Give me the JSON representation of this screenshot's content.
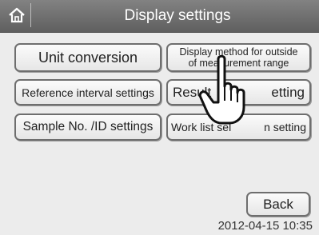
{
  "header": {
    "title": "Display settings",
    "home_icon": "home-icon"
  },
  "buttons": {
    "unit_conversion": "Unit conversion",
    "display_method_line1": "Display method for outside",
    "display_method_line2": "of measurement range",
    "reference_interval": "Reference interval settings",
    "result_setting_part1": "Result",
    "result_setting_part2": "etting",
    "sample_no_id": "Sample No. /ID settings",
    "work_list_part1": "Work list sel",
    "work_list_part2": "n setting",
    "back": "Back"
  },
  "footer": {
    "timestamp": "2012-04-15 10:35"
  },
  "overlay": {
    "pointer_icon": "hand-pointer-icon"
  },
  "colors": {
    "titlebar": "#6e6e6e",
    "background": "#ececec",
    "button_border": "#6e6e6e"
  }
}
